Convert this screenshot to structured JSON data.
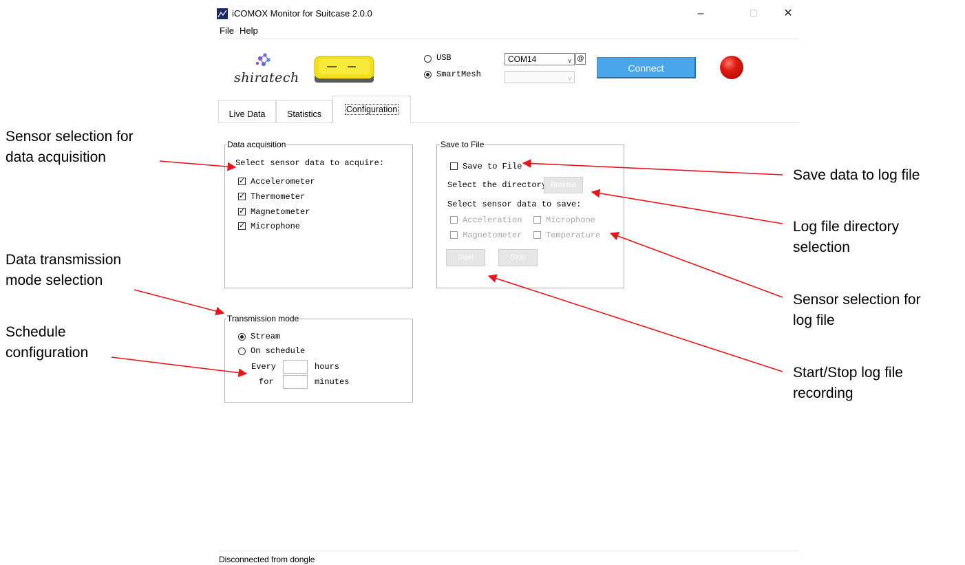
{
  "window": {
    "title": "iCOMOX Monitor for Suitcase 2.0.0",
    "minimize": "–",
    "maximize": "☐",
    "close": "✕"
  },
  "menu": [
    "File",
    "Help"
  ],
  "header": {
    "logo_text": "shiratech",
    "usb_label": "USB",
    "smartmesh_label": "SmartMesh",
    "selected_connection": "SmartMesh",
    "port_value": "COM14",
    "at_label": "@",
    "mesh_value": "",
    "connect_label": "Connect",
    "led_color": "#e01a12",
    "connect_color": "#4aa6ea"
  },
  "tabs": [
    {
      "label": "Live Data",
      "active": false
    },
    {
      "label": "Statistics",
      "active": false
    },
    {
      "label": "Configuration",
      "active": true
    }
  ],
  "data_acquisition": {
    "legend": "Data acquisition",
    "prompt": "Select sensor data to acquire:",
    "sensors": [
      {
        "label": "Accelerometer",
        "checked": true
      },
      {
        "label": "Thermometer",
        "checked": true
      },
      {
        "label": "Magnetometer",
        "checked": true
      },
      {
        "label": "Microphone",
        "checked": true
      }
    ]
  },
  "save_to_file": {
    "legend": "Save to File",
    "checkbox_label": "Save to File",
    "checked": false,
    "directory_label": "Select the directory:",
    "browse_label": "Browse",
    "sensor_prompt": "Select sensor data to save:",
    "sensors": [
      "Acceleration",
      "Microphone",
      "Magnetometer",
      "Temperature"
    ],
    "start_label": "Start",
    "stop_label": "Stop"
  },
  "transmission_mode": {
    "legend": "Transmission mode",
    "stream_label": "Stream",
    "schedule_label": "On schedule",
    "selected": "Stream",
    "every_label": "Every",
    "hours_label": "hours",
    "for_label": "for",
    "minutes_label": "minutes",
    "hours_value": "",
    "minutes_value": ""
  },
  "status": "Disconnected from dongle",
  "annotations": {
    "sensor_acq": [
      "Sensor selection for",
      "data acquisition"
    ],
    "transmission": [
      "Data transmission",
      "mode selection"
    ],
    "schedule": [
      "Schedule",
      "configuration"
    ],
    "save_log": [
      "Save data to log file"
    ],
    "log_dir": [
      "Log file directory",
      "selection"
    ],
    "sensor_log": [
      "Sensor selection for",
      "log file"
    ],
    "start_stop": [
      "Start/Stop log file",
      "recording"
    ],
    "arrow_color": "#e8161b"
  }
}
